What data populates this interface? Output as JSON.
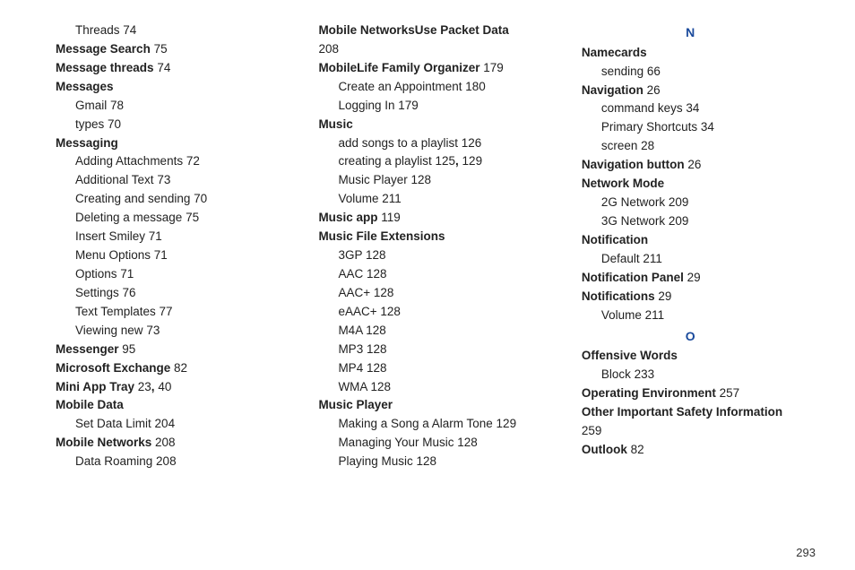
{
  "page_number": "293",
  "columns": [
    {
      "rows": [
        {
          "indent": 2,
          "parts": [
            {
              "t": "Threads "
            },
            {
              "t": "74"
            }
          ]
        },
        {
          "indent": 1,
          "parts": [
            {
              "t": "Message Search ",
              "b": true
            },
            {
              "t": "75"
            }
          ]
        },
        {
          "indent": 1,
          "parts": [
            {
              "t": "Message threads ",
              "b": true
            },
            {
              "t": "74"
            }
          ]
        },
        {
          "indent": 1,
          "parts": [
            {
              "t": "Messages",
              "b": true
            }
          ]
        },
        {
          "indent": 2,
          "parts": [
            {
              "t": "Gmail "
            },
            {
              "t": "78"
            }
          ]
        },
        {
          "indent": 2,
          "parts": [
            {
              "t": "types "
            },
            {
              "t": "70"
            }
          ]
        },
        {
          "indent": 1,
          "parts": [
            {
              "t": "Messaging",
              "b": true
            }
          ]
        },
        {
          "indent": 2,
          "parts": [
            {
              "t": "Adding Attachments "
            },
            {
              "t": "72"
            }
          ]
        },
        {
          "indent": 2,
          "parts": [
            {
              "t": "Additional Text "
            },
            {
              "t": "73"
            }
          ]
        },
        {
          "indent": 2,
          "parts": [
            {
              "t": "Creating and sending "
            },
            {
              "t": "70"
            }
          ]
        },
        {
          "indent": 2,
          "parts": [
            {
              "t": "Deleting a message "
            },
            {
              "t": "75"
            }
          ]
        },
        {
          "indent": 2,
          "parts": [
            {
              "t": "Insert Smiley "
            },
            {
              "t": "71"
            }
          ]
        },
        {
          "indent": 2,
          "parts": [
            {
              "t": "Menu Options "
            },
            {
              "t": "71"
            }
          ]
        },
        {
          "indent": 2,
          "parts": [
            {
              "t": "Options "
            },
            {
              "t": "71"
            }
          ]
        },
        {
          "indent": 2,
          "parts": [
            {
              "t": "Settings "
            },
            {
              "t": "76"
            }
          ]
        },
        {
          "indent": 2,
          "parts": [
            {
              "t": "Text Templates "
            },
            {
              "t": "77"
            }
          ]
        },
        {
          "indent": 2,
          "parts": [
            {
              "t": "Viewing new "
            },
            {
              "t": "73"
            }
          ]
        },
        {
          "indent": 1,
          "parts": [
            {
              "t": "Messenger ",
              "b": true
            },
            {
              "t": "95"
            }
          ]
        },
        {
          "indent": 1,
          "parts": [
            {
              "t": "Microsoft Exchange ",
              "b": true
            },
            {
              "t": "82"
            }
          ]
        },
        {
          "indent": 1,
          "parts": [
            {
              "t": "Mini App Tray ",
              "b": true
            },
            {
              "t": "23"
            },
            {
              "t": ", ",
              "b": true
            },
            {
              "t": "40"
            }
          ]
        },
        {
          "indent": 1,
          "parts": [
            {
              "t": "Mobile Data",
              "b": true
            }
          ]
        },
        {
          "indent": 2,
          "parts": [
            {
              "t": "Set Data Limit "
            },
            {
              "t": "204"
            }
          ]
        },
        {
          "indent": 1,
          "parts": [
            {
              "t": "Mobile Networks ",
              "b": true
            },
            {
              "t": "208"
            }
          ]
        },
        {
          "indent": 2,
          "parts": [
            {
              "t": "Data Roaming "
            },
            {
              "t": "208"
            }
          ]
        }
      ]
    },
    {
      "rows": [
        {
          "indent": 1,
          "parts": [
            {
              "t": "Mobile NetworksUse Packet Data ",
              "b": true
            }
          ]
        },
        {
          "indent": 1,
          "parts": [
            {
              "t": "208"
            }
          ]
        },
        {
          "indent": 1,
          "parts": [
            {
              "t": "MobileLife Family Organizer ",
              "b": true
            },
            {
              "t": "179"
            }
          ]
        },
        {
          "indent": 2,
          "parts": [
            {
              "t": "Create an Appointment "
            },
            {
              "t": "180"
            }
          ]
        },
        {
          "indent": 2,
          "parts": [
            {
              "t": "Logging In "
            },
            {
              "t": "179"
            }
          ]
        },
        {
          "indent": 1,
          "parts": [
            {
              "t": "Music",
              "b": true
            }
          ]
        },
        {
          "indent": 2,
          "parts": [
            {
              "t": "add songs to a playlist "
            },
            {
              "t": "126"
            }
          ]
        },
        {
          "indent": 2,
          "parts": [
            {
              "t": "creating a playlist "
            },
            {
              "t": "125"
            },
            {
              "t": ", ",
              "b": true
            },
            {
              "t": "129"
            }
          ]
        },
        {
          "indent": 2,
          "parts": [
            {
              "t": "Music Player "
            },
            {
              "t": "128"
            }
          ]
        },
        {
          "indent": 2,
          "parts": [
            {
              "t": "Volume "
            },
            {
              "t": "211"
            }
          ]
        },
        {
          "indent": 1,
          "parts": [
            {
              "t": "Music app ",
              "b": true
            },
            {
              "t": "119"
            }
          ]
        },
        {
          "indent": 1,
          "parts": [
            {
              "t": "Music File Extensions",
              "b": true
            }
          ]
        },
        {
          "indent": 2,
          "parts": [
            {
              "t": "3GP "
            },
            {
              "t": "128"
            }
          ]
        },
        {
          "indent": 2,
          "parts": [
            {
              "t": "AAC "
            },
            {
              "t": "128"
            }
          ]
        },
        {
          "indent": 2,
          "parts": [
            {
              "t": "AAC+ "
            },
            {
              "t": "128"
            }
          ]
        },
        {
          "indent": 2,
          "parts": [
            {
              "t": "eAAC+ "
            },
            {
              "t": "128"
            }
          ]
        },
        {
          "indent": 2,
          "parts": [
            {
              "t": "M4A "
            },
            {
              "t": "128"
            }
          ]
        },
        {
          "indent": 2,
          "parts": [
            {
              "t": "MP3 "
            },
            {
              "t": "128"
            }
          ]
        },
        {
          "indent": 2,
          "parts": [
            {
              "t": "MP4 "
            },
            {
              "t": "128"
            }
          ]
        },
        {
          "indent": 2,
          "parts": [
            {
              "t": "WMA "
            },
            {
              "t": "128"
            }
          ]
        },
        {
          "indent": 1,
          "parts": [
            {
              "t": "Music Player",
              "b": true
            }
          ]
        },
        {
          "indent": 2,
          "parts": [
            {
              "t": "Making a Song a Alarm Tone "
            },
            {
              "t": "129"
            }
          ]
        },
        {
          "indent": 2,
          "parts": [
            {
              "t": "Managing Your Music "
            },
            {
              "t": "128"
            }
          ]
        },
        {
          "indent": 2,
          "parts": [
            {
              "t": "Playing Music "
            },
            {
              "t": "128"
            }
          ]
        }
      ]
    },
    {
      "rows": [
        {
          "letter": "N"
        },
        {
          "indent": 1,
          "parts": [
            {
              "t": "Namecards",
              "b": true
            }
          ]
        },
        {
          "indent": 2,
          "parts": [
            {
              "t": "sending "
            },
            {
              "t": "66"
            }
          ]
        },
        {
          "indent": 1,
          "parts": [
            {
              "t": "Navigation ",
              "b": true
            },
            {
              "t": "26"
            }
          ]
        },
        {
          "indent": 2,
          "parts": [
            {
              "t": "command keys "
            },
            {
              "t": "34"
            }
          ]
        },
        {
          "indent": 2,
          "parts": [
            {
              "t": "Primary Shortcuts "
            },
            {
              "t": "34"
            }
          ]
        },
        {
          "indent": 2,
          "parts": [
            {
              "t": "screen "
            },
            {
              "t": "28"
            }
          ]
        },
        {
          "indent": 1,
          "parts": [
            {
              "t": "Navigation button ",
              "b": true
            },
            {
              "t": "26"
            }
          ]
        },
        {
          "indent": 1,
          "parts": [
            {
              "t": "Network Mode",
              "b": true
            }
          ]
        },
        {
          "indent": 2,
          "parts": [
            {
              "t": "2G Network "
            },
            {
              "t": "209"
            }
          ]
        },
        {
          "indent": 2,
          "parts": [
            {
              "t": "3G Network "
            },
            {
              "t": "209"
            }
          ]
        },
        {
          "indent": 1,
          "parts": [
            {
              "t": "Notification",
              "b": true
            }
          ]
        },
        {
          "indent": 2,
          "parts": [
            {
              "t": "Default "
            },
            {
              "t": "211"
            }
          ]
        },
        {
          "indent": 1,
          "parts": [
            {
              "t": "Notification Panel ",
              "b": true
            },
            {
              "t": "29"
            }
          ]
        },
        {
          "indent": 1,
          "parts": [
            {
              "t": "Notifications ",
              "b": true
            },
            {
              "t": "29"
            }
          ]
        },
        {
          "indent": 2,
          "parts": [
            {
              "t": "Volume "
            },
            {
              "t": "211"
            }
          ]
        },
        {
          "letter": "O"
        },
        {
          "indent": 1,
          "parts": [
            {
              "t": "Offensive Words",
              "b": true
            }
          ]
        },
        {
          "indent": 2,
          "parts": [
            {
              "t": "Block "
            },
            {
              "t": "233"
            }
          ]
        },
        {
          "indent": 1,
          "parts": [
            {
              "t": "Operating Environment ",
              "b": true
            },
            {
              "t": "257"
            }
          ]
        },
        {
          "indent": 1,
          "parts": [
            {
              "t": "Other Important Safety Information ",
              "b": true
            }
          ]
        },
        {
          "indent": 1,
          "parts": [
            {
              "t": "259"
            }
          ]
        },
        {
          "indent": 1,
          "parts": [
            {
              "t": "Outlook ",
              "b": true
            },
            {
              "t": "82"
            }
          ]
        }
      ]
    }
  ]
}
